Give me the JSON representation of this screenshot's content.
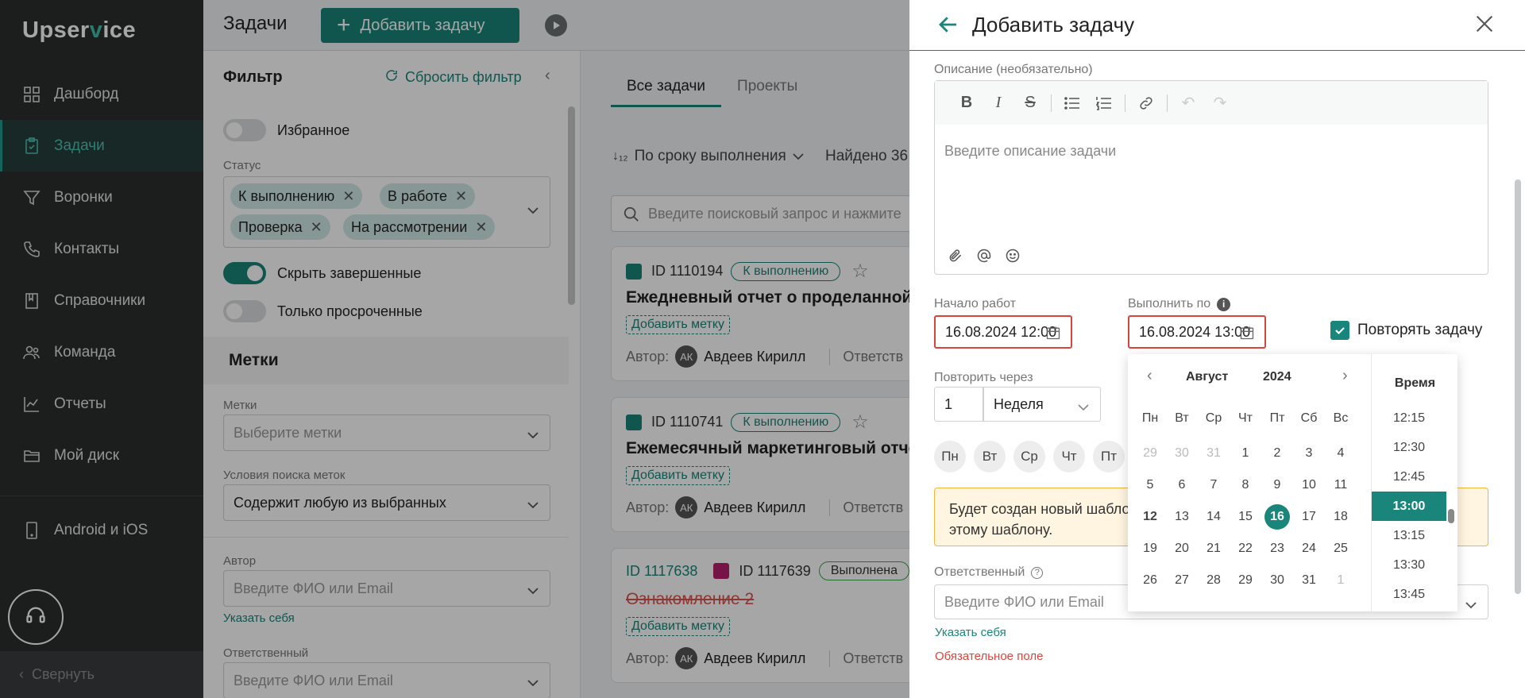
{
  "sidebar": {
    "logo_pre": "Upser",
    "logo_v": "v",
    "logo_post": "ice",
    "items": [
      {
        "label": "Дашборд"
      },
      {
        "label": "Задачи"
      },
      {
        "label": "Воронки"
      },
      {
        "label": "Контакты"
      },
      {
        "label": "Справочники"
      },
      {
        "label": "Команда"
      },
      {
        "label": "Отчеты"
      },
      {
        "label": "Мой диск"
      },
      {
        "label": "Android и iOS"
      }
    ],
    "collapse_label": "Свернуть"
  },
  "topbar": {
    "title": "Задачи",
    "add_label": "Добавить задачу"
  },
  "filter": {
    "title": "Фильтр",
    "reset_label": "Сбросить фильтр",
    "favorites_label": "Избранное",
    "status_label": "Статус",
    "statuses": [
      "К выполнению",
      "В работе",
      "Проверка",
      "На рассмотрении"
    ],
    "hide_done_label": "Скрыть завершенные",
    "overdue_label": "Только просроченные",
    "tags_section": "Метки",
    "tags_label": "Метки",
    "tags_placeholder": "Выберите метки",
    "tag_cond_label": "Условия поиска меток",
    "tag_cond_value": "Содержит любую из выбранных",
    "author_label": "Автор",
    "author_placeholder": "Введите ФИО или Email",
    "set_me": "Указать себя",
    "resp_label": "Ответственный",
    "resp_placeholder": "Введите ФИО или Email"
  },
  "tasks": {
    "tabs": [
      "Все задачи",
      "Проекты"
    ],
    "sort_label": "По сроку выполнения",
    "found_label": "Найдено 36",
    "search_placeholder": "Введите поисковый запрос и нажмите",
    "cards": [
      {
        "id": "ID 1110194",
        "status": "К выполнению",
        "title": "Ежедневный отчет о проделанной",
        "add_tag": "Добавить метку",
        "author_prefix": "Автор:",
        "avatar": "АК",
        "author": "Авдеев Кирилл",
        "resp": "Ответств"
      },
      {
        "id": "ID 1110741",
        "status": "К выполнению",
        "title": "Ежемесячный маркетинговый отче",
        "add_tag": "Добавить метку",
        "author_prefix": "Автор:",
        "avatar": "АК",
        "author": "Авдеев Кирилл",
        "resp": "Ответств"
      },
      {
        "id": "ID 1117638",
        "id2": "ID 1117639",
        "status": "Выполнена",
        "title": "Ознакомление 2",
        "add_tag": "Добавить метку",
        "author_prefix": "Автор:",
        "avatar": "АК",
        "author": "Авдеев Кирилл",
        "resp": "Ответств"
      }
    ]
  },
  "drawer": {
    "title": "Добавить задачу",
    "desc_label": "Описание (необязательно)",
    "desc_placeholder": "Введите описание задачи",
    "start_label": "Начало работ",
    "start_value": "16.08.2024 12:00",
    "due_label": "Выполнить по",
    "due_value": "16.08.2024 13:00",
    "repeat_label": "Повторять задачу",
    "repeat_every_label": "Повторить через",
    "repeat_count": "1",
    "repeat_period": "Неделя",
    "weekdays": [
      "Пн",
      "Вт",
      "Ср",
      "Чт",
      "Пт"
    ],
    "notice_line1": "Будет создан новый шабло",
    "notice_line2": "этому шаблону.",
    "resp_label": "Ответственный",
    "resp_placeholder": "Введите ФИО или Email",
    "set_me": "Указать себя",
    "required": "Обязательное поле"
  },
  "picker": {
    "month": "Август",
    "year": "2024",
    "time_title": "Время",
    "weekdays": [
      "Пн",
      "Вт",
      "Ср",
      "Чт",
      "Пт",
      "Сб",
      "Вс"
    ],
    "weeks": [
      [
        "29",
        "30",
        "31",
        "1",
        "2",
        "3",
        "4"
      ],
      [
        "5",
        "6",
        "7",
        "8",
        "9",
        "10",
        "11"
      ],
      [
        "12",
        "13",
        "14",
        "15",
        "16",
        "17",
        "18"
      ],
      [
        "19",
        "20",
        "21",
        "22",
        "23",
        "24",
        "25"
      ],
      [
        "26",
        "27",
        "28",
        "29",
        "30",
        "31",
        "1"
      ]
    ],
    "times": [
      "12:15",
      "12:30",
      "12:45",
      "13:00",
      "13:15",
      "13:30",
      "13:45"
    ],
    "accent": "#1a857a"
  }
}
